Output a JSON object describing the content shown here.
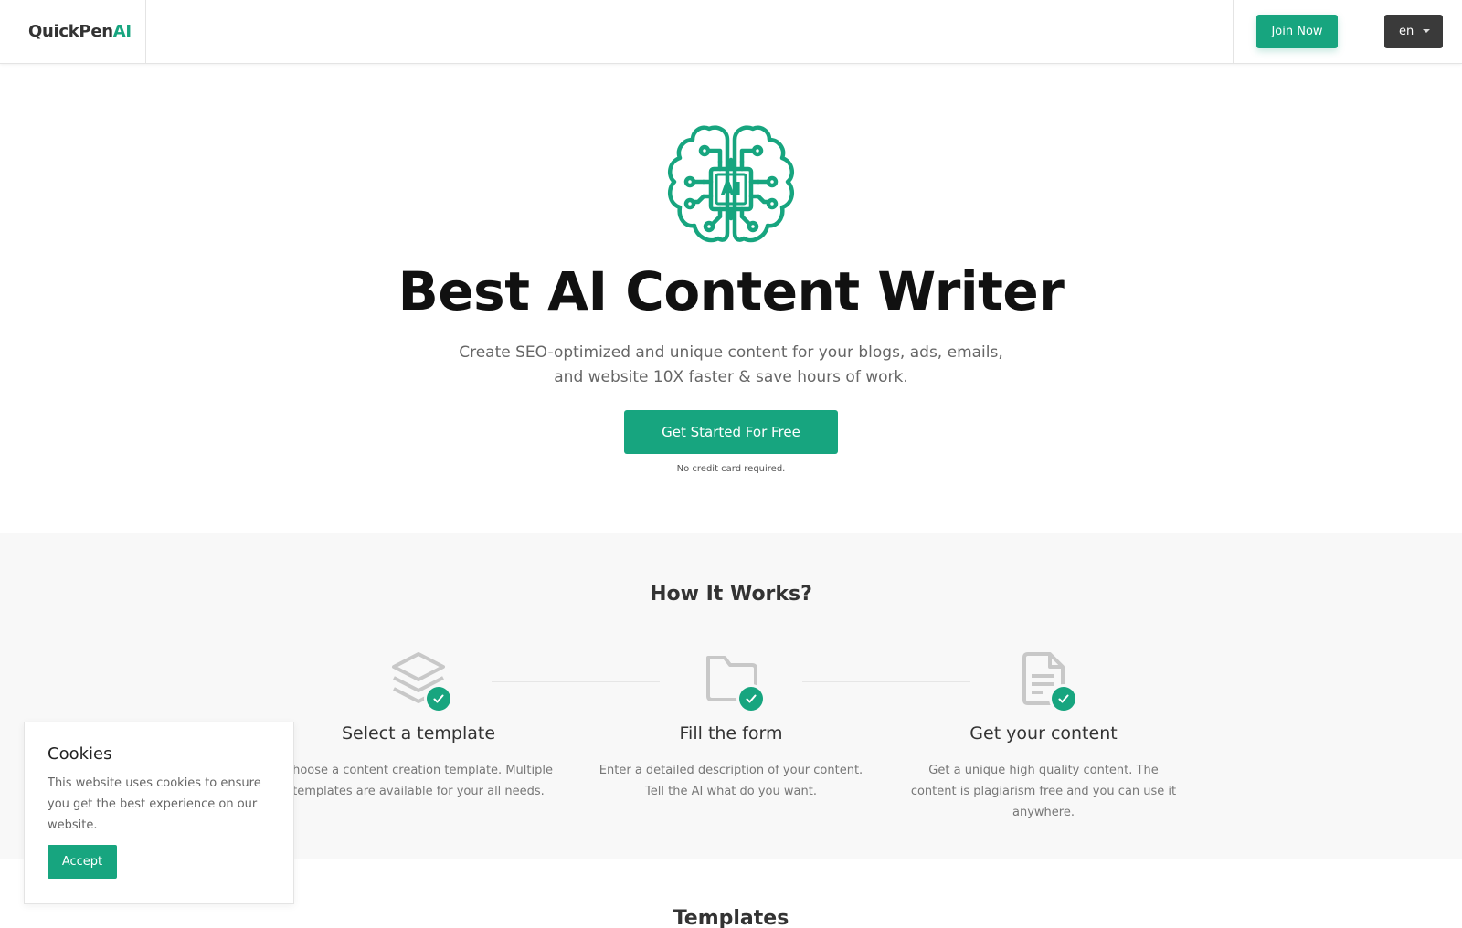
{
  "header": {
    "logo_main": "QuickPen",
    "logo_accent": "AI",
    "join_label": "Join Now",
    "language": "en"
  },
  "hero": {
    "title": "Best AI Content Writer",
    "subtitle": "Create SEO-optimized and unique content for your blogs, ads, emails, and website 10X faster & save hours of work.",
    "cta_label": "Get Started For Free",
    "note": "No credit card required.",
    "icon_text": "AI"
  },
  "how": {
    "title": "How It Works?",
    "steps": [
      {
        "icon": "layers-icon",
        "title": "Select a template",
        "text": "Choose a content creation template. Multiple templates are available for your all needs."
      },
      {
        "icon": "folder-icon",
        "title": "Fill the form",
        "text": "Enter a detailed description of your content. Tell the AI what do you want."
      },
      {
        "icon": "document-icon",
        "title": "Get your content",
        "text": "Get a unique high quality content. The content is plagiarism free and you can use it anywhere."
      }
    ]
  },
  "cookies": {
    "title": "Cookies",
    "text": "This website uses cookies to ensure you get the best experience on our website.",
    "accept_label": "Accept"
  },
  "templates": {
    "title": "Templates"
  },
  "colors": {
    "accent": "#17a57f",
    "dark_button": "#3a3a3a",
    "section_bg": "#f8f8f8"
  }
}
